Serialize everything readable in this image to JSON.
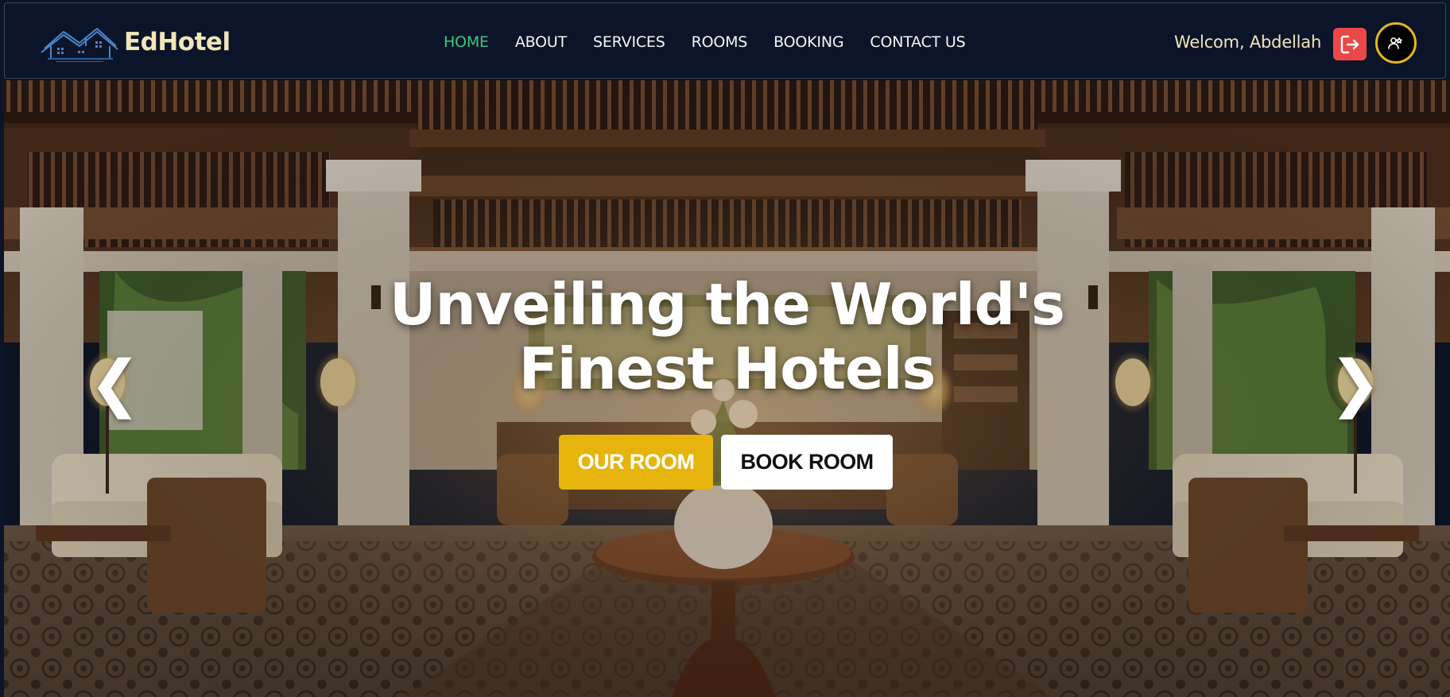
{
  "brand": {
    "name": "EdHotel",
    "logo_icon": "hotel-house-logo"
  },
  "nav": {
    "items": [
      {
        "label": "HOME",
        "active": true
      },
      {
        "label": "ABOUT",
        "active": false
      },
      {
        "label": "SERVICES",
        "active": false
      },
      {
        "label": "ROOMS",
        "active": false
      },
      {
        "label": "BOOKING",
        "active": false
      },
      {
        "label": "CONTACT US",
        "active": false
      }
    ]
  },
  "user": {
    "welcome": "Welcom, Abdellah",
    "logout_icon": "logout-icon",
    "avatar_icon": "avatar-icon"
  },
  "hero": {
    "title_line1": "Unveiling the World's",
    "title_line2": "Finest Hotels",
    "primary_button": "OUR ROOM",
    "secondary_button": "BOOK ROOM",
    "prev_arrow": "❮",
    "next_arrow": "❯"
  },
  "colors": {
    "nav_background": "#0c1429",
    "active_link": "#3bc97a",
    "brand_text": "#f1e6b8",
    "accent_gold": "#e6b40c",
    "logout_red": "#ea4848"
  }
}
